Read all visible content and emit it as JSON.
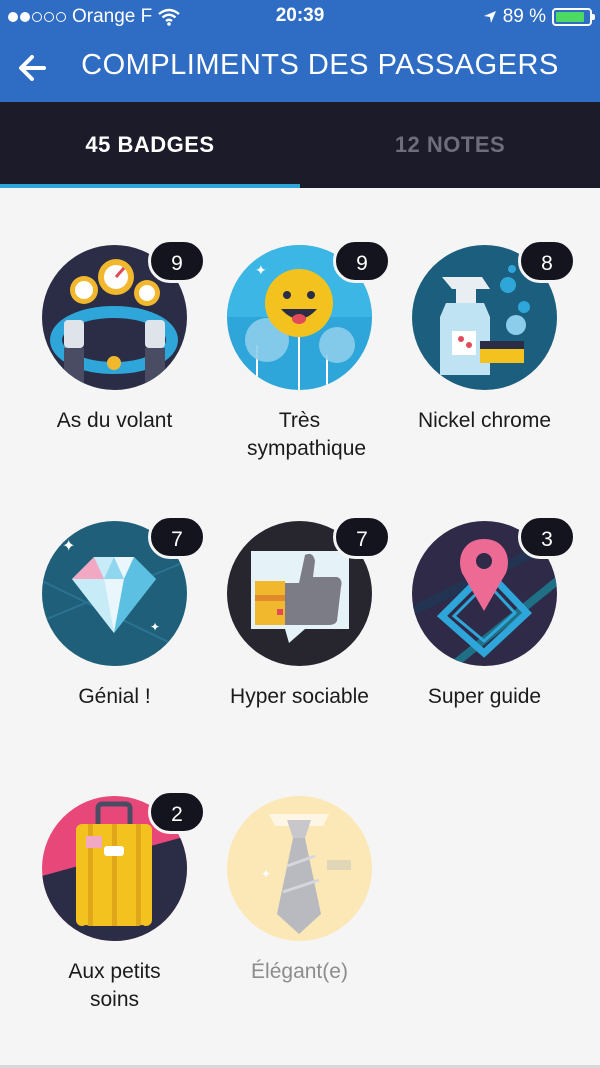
{
  "status": {
    "carrier": "Orange F",
    "time": "20:39",
    "battery_percent": "89 %",
    "battery_level": 0.89
  },
  "nav": {
    "title": "COMPLIMENTS DES PASSAGERS"
  },
  "tabs": [
    {
      "label": "45 BADGES",
      "active": true
    },
    {
      "label": "12 NOTES",
      "active": false
    }
  ],
  "badges": [
    {
      "label": "As du volant",
      "count": "9",
      "icon": "steering-wheel-icon"
    },
    {
      "label": "Très sympathique",
      "count": "9",
      "icon": "smiley-balloon-icon"
    },
    {
      "label": "Nickel chrome",
      "count": "8",
      "icon": "cleaning-spray-icon"
    },
    {
      "label": "Génial !",
      "count": "7",
      "icon": "diamond-icon"
    },
    {
      "label": "Hyper sociable",
      "count": "7",
      "icon": "thumbs-up-icon"
    },
    {
      "label": "Super guide",
      "count": "3",
      "icon": "map-pin-icon"
    },
    {
      "label": "Aux petits soins",
      "count": "2",
      "icon": "suitcase-icon"
    },
    {
      "label": "Élégant(e)",
      "count": "",
      "icon": "tie-icon"
    }
  ],
  "colors": {
    "nav_blue": "#2f6cc4",
    "tab_bar": "#1c1b29",
    "tab_indicator": "#2fa6d9",
    "count_bubble": "#14141f"
  }
}
